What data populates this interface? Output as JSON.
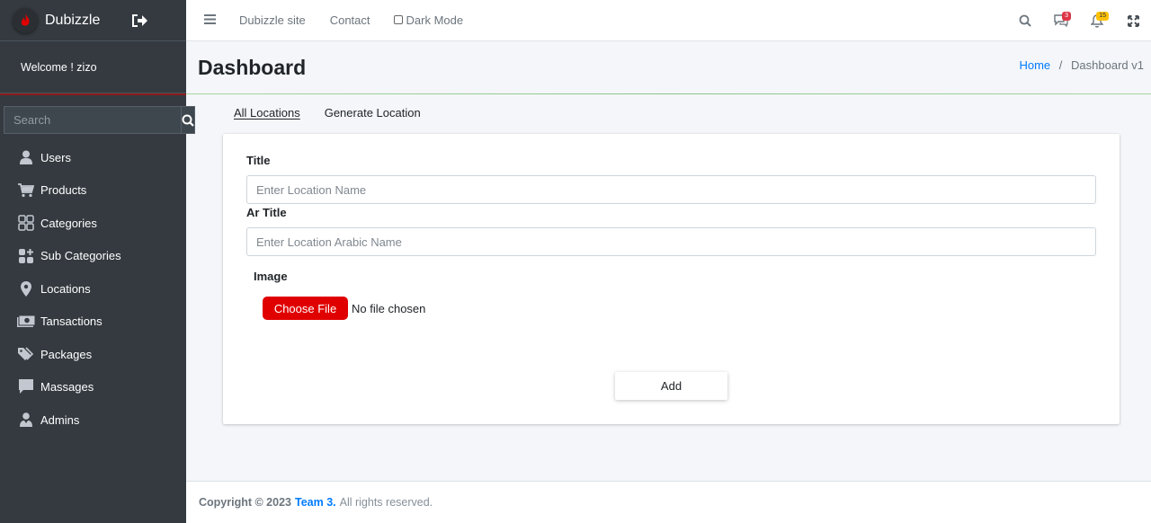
{
  "sidebar": {
    "brand": "Dubizzle",
    "welcome": "Welcome ! zizo",
    "search_placeholder": "Search",
    "items": [
      {
        "label": "Users",
        "icon": "user-icon"
      },
      {
        "label": "Products",
        "icon": "cart-icon"
      },
      {
        "label": "Categories",
        "icon": "grid-icon"
      },
      {
        "label": "Sub Categories",
        "icon": "apps-plus-icon"
      },
      {
        "label": "Locations",
        "icon": "map-marker-icon"
      },
      {
        "label": "Tansactions",
        "icon": "money-icon"
      },
      {
        "label": "Packages",
        "icon": "tags-icon"
      },
      {
        "label": "Massages",
        "icon": "comment-icon"
      },
      {
        "label": "Admins",
        "icon": "user-tie-icon"
      }
    ]
  },
  "navbar": {
    "links": [
      "Dubizzle site",
      "Contact"
    ],
    "dark_mode_label": "Dark Mode",
    "messages_badge": "3",
    "notifications_badge": "15"
  },
  "header": {
    "title": "Dashboard",
    "breadcrumb_home": "Home",
    "breadcrumb_sep": "/",
    "breadcrumb_current": "Dashboard v1"
  },
  "tabs": [
    "All Locations",
    "Generate Location"
  ],
  "form": {
    "title_label": "Title",
    "title_placeholder": "Enter Location Name",
    "ar_title_label": "Ar Title",
    "ar_title_placeholder": "Enter Location Arabic Name",
    "image_label": "Image",
    "file_button": "Choose File",
    "file_status": "No file chosen",
    "submit_label": "Add"
  },
  "footer": {
    "copyright": "Copyright © 2023",
    "team": "Team 3.",
    "rights": "All rights reserved."
  },
  "colors": {
    "sidebar_bg": "#343a40",
    "accent_red": "#e00000",
    "link_blue": "#007bff"
  }
}
